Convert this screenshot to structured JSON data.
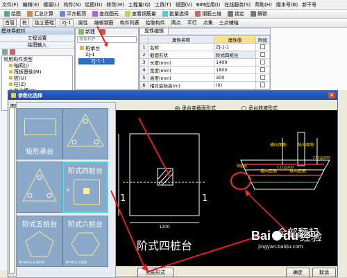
{
  "menu": [
    "文件(F)",
    "编辑(E)",
    "楼层(L)",
    "构件(N)",
    "绘图(D)",
    "修改(M)",
    "工程量(Q)",
    "工具(T)",
    "视图(V)",
    "BIM应用(I)",
    "在线服务(S)",
    "帮助(H)",
    "版本号(B)",
    "新干号"
  ],
  "menu_right": "钢 我是国标筋检测",
  "toolbar1": [
    "绘图",
    "汇总计算",
    "平齐板顶",
    "查找图元",
    "查看钢筋量",
    "批量选择",
    "钢筋三维",
    "锁定",
    "解锁"
  ],
  "toolbar2": [
    "删除",
    "复制",
    "镜像",
    "移动",
    "旋转",
    "延伸",
    "修剪",
    "打断",
    "合并",
    "分割",
    "对齐",
    "偏移",
    "拉伸",
    "设置夹点"
  ],
  "toolbar3": [
    "首层",
    "桩",
    "独立基础",
    "ZJ-1",
    "属性",
    "编辑钢筋",
    "构件列表",
    "拾取构件",
    "两点",
    "平行",
    "点角",
    "三点辅轴"
  ],
  "nav": {
    "title": "模块导航栏",
    "items": [
      "工程设置",
      "绘图输入"
    ],
    "section": "常用构件类型",
    "tree": [
      "轴网(J)",
      "筏板基础(M)",
      "桩(U)",
      "柱(Z)",
      "剪力墙(Q)",
      "梁(L)",
      "板(B)",
      "基础"
    ]
  },
  "search": {
    "placeholder": "搜索构件..."
  },
  "comp_tree": {
    "root": "桩承台",
    "group": "ZJ-1",
    "child": "ZJ-1-1"
  },
  "comp_tb": [
    "新建",
    "删除",
    "复制",
    "重命名",
    "楼层",
    "排序",
    "过滤",
    "从其他楼层复制构件",
    "复制构件到其他楼层"
  ],
  "props": {
    "tab": "属性编辑",
    "headers": [
      "属性名称",
      "属性值",
      "附加"
    ],
    "rows": [
      [
        "名称",
        "ZJ-1-1"
      ],
      [
        "截面形状",
        "阶式四桩台"
      ],
      [
        "长度(mm)",
        "1400"
      ],
      [
        "宽度(mm)",
        "1800"
      ],
      [
        "高度(mm)",
        "300"
      ],
      [
        "相对底标高(m)",
        "(0)"
      ]
    ]
  },
  "dialog": {
    "title": "参数化选择",
    "tree_label": "图库",
    "radio1": "承台变截面形式",
    "radio2": "承台放坡形式",
    "ok": "确定",
    "cancel": "取消",
    "bottom_btn": "配筋形式"
  },
  "thumbs": [
    "矩形承台",
    "三桩承台",
    "阶式四桩台",
    "阶式四桩台",
    "阶式五桩台",
    "阶式六桩台"
  ],
  "thumb_dims": [
    "B=A/2+2.5095",
    "B=A/1.7326"
  ],
  "cad": {
    "main_title": "阶式四桩台",
    "width_dim": "1200",
    "left_label": "1",
    "right_label": "1",
    "lbl_top1": "横向面筋",
    "lbl_top2": "纵向面筋",
    "lbl_bot1": "横向底筋",
    "lbl_bot2": "纵向底筋",
    "rebar_a": "C12@200",
    "rebar_b": "C12@200",
    "side": "侧面筋"
  },
  "annotation": "全部翻起",
  "watermark": {
    "brand": "Bai",
    "brand2": "du",
    "word": "经验",
    "url": "jingyan.baidu.com"
  }
}
